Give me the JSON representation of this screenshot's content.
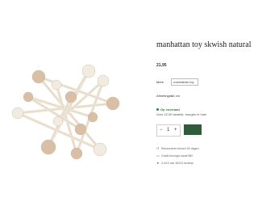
{
  "product": {
    "title": "manhattan toy skwish natural",
    "price": "21,95",
    "brand_label": "Merk",
    "brand_value": "manhattan toy",
    "size_label": "Afmetingen",
    "size_value": "14 cm",
    "stock_status": "Op voorraad",
    "delivery_text": "Voor 22.00 besteld, morgen in huis",
    "quantity": "1",
    "minus_symbol": "−",
    "plus_symbol": "+"
  },
  "usps": [
    {
      "icon": "return-icon",
      "text": "Retourneren binnen 60 dagen"
    },
    {
      "icon": "truck-icon",
      "text": "Gratis bezorgd vanaf €50"
    },
    {
      "icon": "star-icon",
      "text": "9,4/10 van 35224 reviews"
    }
  ],
  "colors": {
    "accent": "#2f5d3c",
    "stock": "#3d7a46",
    "wood_bead": "#d9bfa6",
    "wood_bead_light": "#f2ebe1",
    "stick": "#efe6d8"
  }
}
